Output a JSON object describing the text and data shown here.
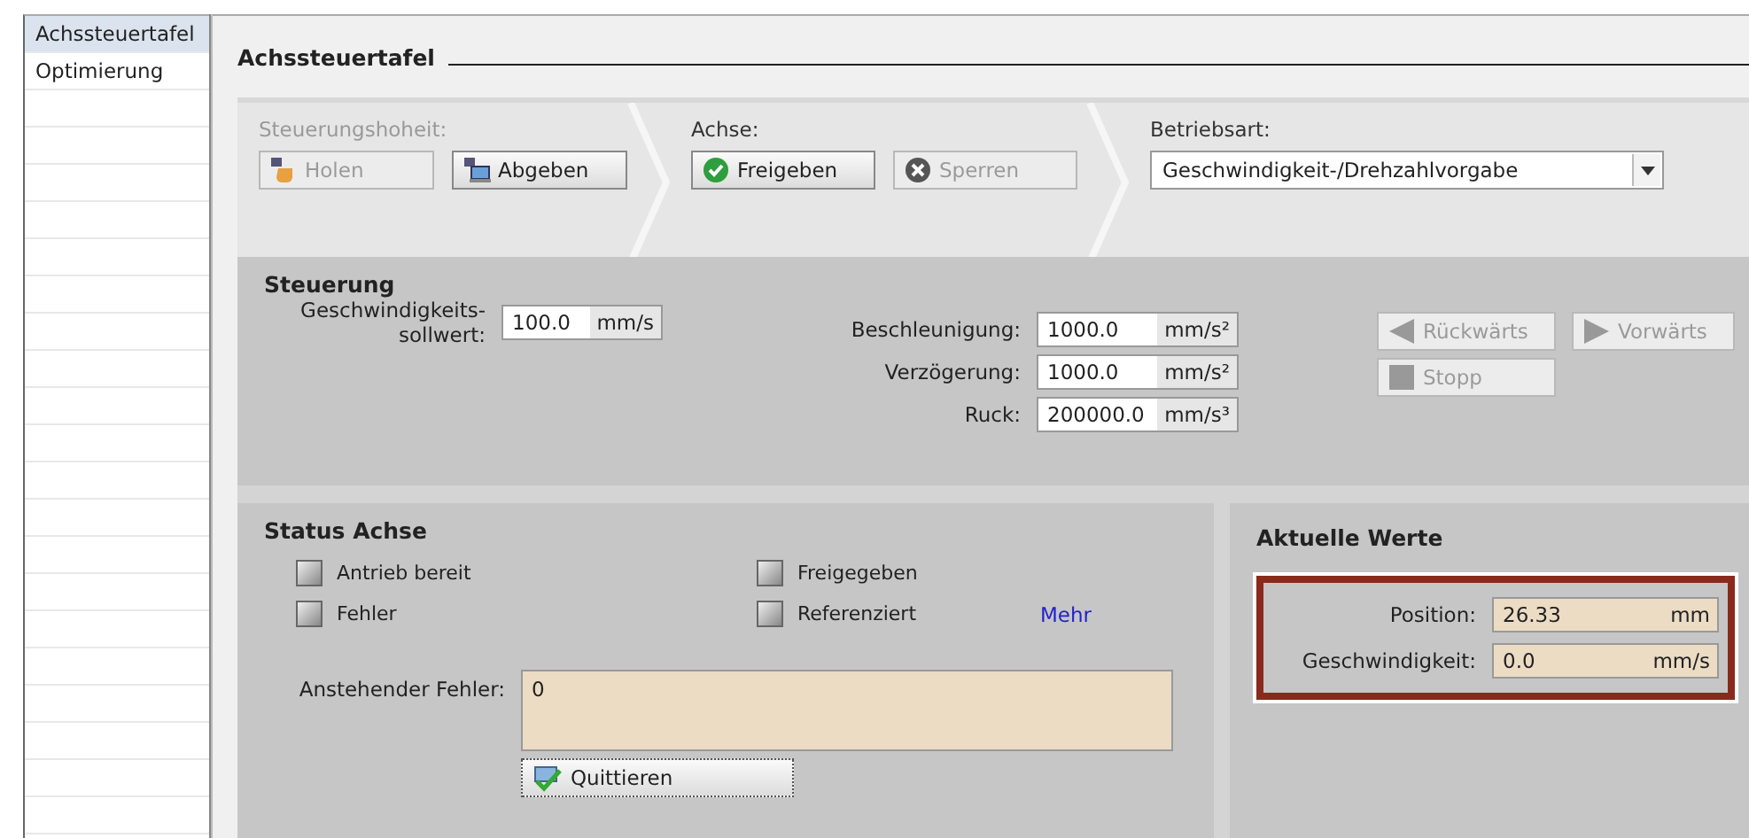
{
  "sidebar": {
    "items": [
      {
        "label": "Achssteuertafel",
        "selected": true
      },
      {
        "label": "Optimierung",
        "selected": false
      }
    ]
  },
  "title": "Achssteuertafel",
  "control_bar": {
    "segments": [
      {
        "kind": "buttons",
        "label": "Steuerungshoheit:",
        "disabled": true,
        "buttons": [
          {
            "label": "Holen",
            "kind": "hand",
            "disabled": true
          },
          {
            "label": "Abgeben",
            "kind": "computer",
            "disabled": false
          }
        ]
      },
      {
        "kind": "buttons",
        "label": "Achse:",
        "disabled": false,
        "buttons": [
          {
            "label": "Freigeben",
            "kind": "check",
            "disabled": false
          },
          {
            "label": "Sperren",
            "kind": "cross",
            "disabled": true
          }
        ]
      },
      {
        "kind": "select",
        "label": "Betriebsart:",
        "disabled": false,
        "value": "Geschwindigkeit-/Drehzahlvorgabe"
      }
    ]
  },
  "steuerung": {
    "title": "Steuerung",
    "setpoint": {
      "label": "Geschwindigkeits-\nsollwert:",
      "value": "100.0",
      "unit": "mm/s"
    },
    "fields": [
      {
        "label": "Beschleunigung:",
        "value": "1000.0",
        "unit": "mm/s²"
      },
      {
        "label": "Verzögerung:",
        "value": "1000.0",
        "unit": "mm/s²"
      },
      {
        "label": "Ruck:",
        "value": "200000.0",
        "unit": "mm/s³"
      }
    ],
    "jog_buttons": [
      {
        "label": "Rückwärts",
        "kind": "back",
        "disabled": true
      },
      {
        "label": "Vorwärts",
        "kind": "forward",
        "disabled": true
      },
      {
        "label": "Stopp",
        "kind": "stop",
        "disabled": true
      }
    ]
  },
  "status": {
    "title": "Status Achse",
    "checks": [
      {
        "label": "Antrieb bereit",
        "checked": false
      },
      {
        "label": "Freigegeben",
        "checked": false
      },
      {
        "label": "Fehler",
        "checked": false
      },
      {
        "label": "Referenziert",
        "checked": false
      }
    ],
    "link": "Mehr",
    "error": {
      "label": "Anstehender Fehler:",
      "value": "0"
    },
    "ack_button": "Quittieren"
  },
  "actual": {
    "title": "Aktuelle Werte",
    "highlighted": true,
    "fields": [
      {
        "label": "Position:",
        "value": "26.33",
        "unit": "mm"
      },
      {
        "label": "Geschwindigkeit:",
        "value": "0.0",
        "unit": "mm/s"
      }
    ]
  }
}
